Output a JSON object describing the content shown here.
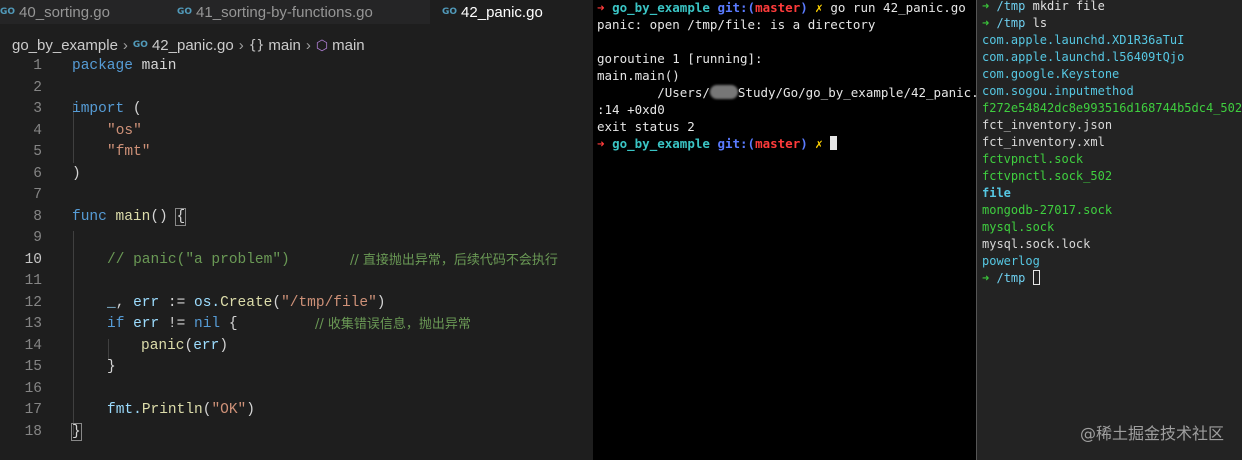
{
  "editor": {
    "tabs": [
      {
        "label": "40_sorting.go"
      },
      {
        "label": "41_sorting-by-functions.go"
      },
      {
        "label": "42_panic.go"
      }
    ],
    "icon_text": "GO",
    "breadcrumb": {
      "folder": "go_by_example",
      "file": "42_panic.go",
      "scope_func": "main",
      "symbol": "main"
    },
    "line_numbers": [
      "1",
      "2",
      "3",
      "4",
      "5",
      "6",
      "7",
      "8",
      "9",
      "10",
      "11",
      "12",
      "13",
      "14",
      "15",
      "16",
      "17",
      "18"
    ],
    "code": {
      "l1_kw": "package",
      "l1_name": " main",
      "l3_kw": "import",
      "l3_rest": " (",
      "l4_str": "\"os\"",
      "l5_str": "\"fmt\"",
      "l6": ")",
      "l8_kw": "func",
      "l8_fn": " main",
      "l8_paren": "() ",
      "l8_brace": "{",
      "l10_comment": "// panic(\"a problem\")",
      "l10_comment2": "// 直接抛出异常，后续代码不会执行",
      "l12_blank": "_",
      "l12_comma": ", ",
      "l12_err": "err",
      "l12_op": " := ",
      "l12_pkg": "os.",
      "l12_fn": "Create",
      "l12_open": "(",
      "l12_str": "\"/tmp/file\"",
      "l12_close": ")",
      "l13_kw": "if",
      "l13_err": " err",
      "l13_op": " != ",
      "l13_nil": "nil",
      "l13_brace": " {",
      "l13_comment": "// 收集错误信息，抛出异常",
      "l14_fn": "panic",
      "l14_open": "(",
      "l14_err": "err",
      "l14_close": ")",
      "l15": "}",
      "l17_pkg": "fmt.",
      "l17_fn": "Println",
      "l17_open": "(",
      "l17_str": "\"OK\"",
      "l17_close": ")",
      "l18": "}"
    }
  },
  "terminal_main": {
    "prompt_arrow": "➜",
    "prompt_dir": "go_by_example",
    "git_label": "git:(",
    "branch": "master",
    "git_close": ")",
    "dirty_mark": "✗",
    "command": "go run 42_panic.go",
    "output": [
      "panic: open /tmp/file: is a directory",
      "",
      "goroutine 1 [running]:",
      "main.main()"
    ],
    "trace_path_prefix": "        /Users/",
    "trace_path_suffix": "Study/Go/go_by_example/42_panic.go",
    "trace_line2": ":14 +0xd0",
    "exit_status": "exit status 2"
  },
  "terminal_side": {
    "prompt_arrow": "➜",
    "cwd": "/tmp",
    "cmd1": "mkdir file",
    "cmd2": "ls",
    "listing": [
      {
        "name": "com.apple.launchd.XD1R36aTuI",
        "kind": "cyan"
      },
      {
        "name": "com.apple.launchd.l56409tQjo",
        "kind": "cyan"
      },
      {
        "name": "com.google.Keystone",
        "kind": "cyan"
      },
      {
        "name": "com.sogou.inputmethod",
        "kind": "cyan"
      },
      {
        "name": "f272e54842dc8e993516d168744b5dc4_502",
        "kind": "green"
      },
      {
        "name": "fct_inventory.json",
        "kind": "plain"
      },
      {
        "name": "fct_inventory.xml",
        "kind": "plain"
      },
      {
        "name": "fctvpnctl.sock",
        "kind": "green"
      },
      {
        "name": "fctvpnctl.sock_502",
        "kind": "green"
      },
      {
        "name": "file",
        "kind": "cyan-bold"
      },
      {
        "name": "mongodb-27017.sock",
        "kind": "green"
      },
      {
        "name": "mysql.sock",
        "kind": "green"
      },
      {
        "name": "mysql.sock.lock",
        "kind": "plain"
      },
      {
        "name": "powerlog",
        "kind": "cyan"
      }
    ]
  },
  "watermark": "@稀土掘金技术社区",
  "colors": {
    "editor_bg": "#1e1e1e",
    "keyword": "#569cd6",
    "string": "#ce9178",
    "function": "#dcdcaa",
    "comment": "#6a9955",
    "terminal_bg": "#000000",
    "prompt_red": "#ff3b3b",
    "git_blue": "#5a7bff"
  }
}
